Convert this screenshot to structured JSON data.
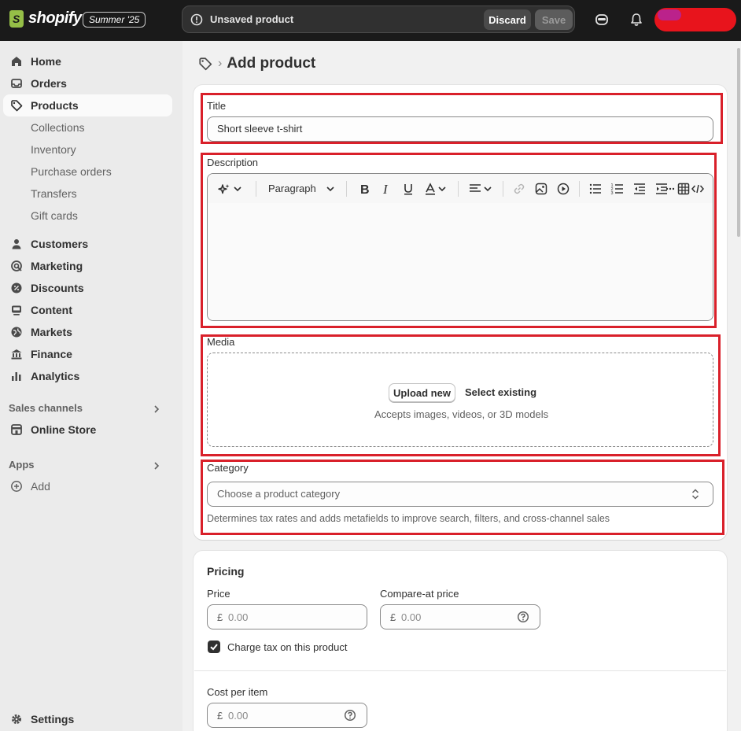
{
  "topbar": {
    "brand": "shopify",
    "edition_badge": "Summer '25",
    "unsaved_text": "Unsaved product",
    "discard_label": "Discard",
    "save_label": "Save",
    "icons": [
      "shopify-bag-icon",
      "alert-circle-icon",
      "sidekick-icon",
      "bell-icon"
    ]
  },
  "sidebar": {
    "items": [
      {
        "label": "Home",
        "icon": "home-icon"
      },
      {
        "label": "Orders",
        "icon": "inbox-icon"
      },
      {
        "label": "Products",
        "icon": "tag-icon",
        "active": true
      },
      {
        "label": "Collections"
      },
      {
        "label": "Inventory"
      },
      {
        "label": "Purchase orders"
      },
      {
        "label": "Transfers"
      },
      {
        "label": "Gift cards"
      },
      {
        "label": "Customers",
        "icon": "person-icon"
      },
      {
        "label": "Marketing",
        "icon": "target-icon"
      },
      {
        "label": "Discounts",
        "icon": "discount-icon"
      },
      {
        "label": "Content",
        "icon": "content-icon"
      },
      {
        "label": "Markets",
        "icon": "globe-icon"
      },
      {
        "label": "Finance",
        "icon": "bank-icon"
      },
      {
        "label": "Analytics",
        "icon": "bar-chart-icon"
      }
    ],
    "sales_channels_label": "Sales channels",
    "online_store_label": "Online Store",
    "apps_label": "Apps",
    "add_label": "Add",
    "settings_label": "Settings"
  },
  "page": {
    "title": "Add product"
  },
  "product": {
    "title_label": "Title",
    "title_value": "Short sleeve t-shirt",
    "description_label": "Description",
    "paragraph_label": "Paragraph",
    "media_label": "Media",
    "upload_label": "Upload new",
    "select_existing_label": "Select existing",
    "media_help": "Accepts images, videos, or 3D models",
    "category_label": "Category",
    "category_placeholder": "Choose a product category",
    "category_help": "Determines tax rates and adds metafields to improve search, filters, and cross-channel sales"
  },
  "pricing": {
    "title": "Pricing",
    "price_label": "Price",
    "compare_label": "Compare-at price",
    "currency": "£",
    "price_placeholder": "0.00",
    "compare_placeholder": "0.00",
    "charge_tax_label": "Charge tax on this product",
    "charge_tax_checked": true,
    "cost_label": "Cost per item",
    "cost_placeholder": "0.00"
  },
  "colors": {
    "topbar_bg": "#1a1a1a",
    "highlight_red": "#d9202a",
    "brand_green": "#95bf47"
  }
}
